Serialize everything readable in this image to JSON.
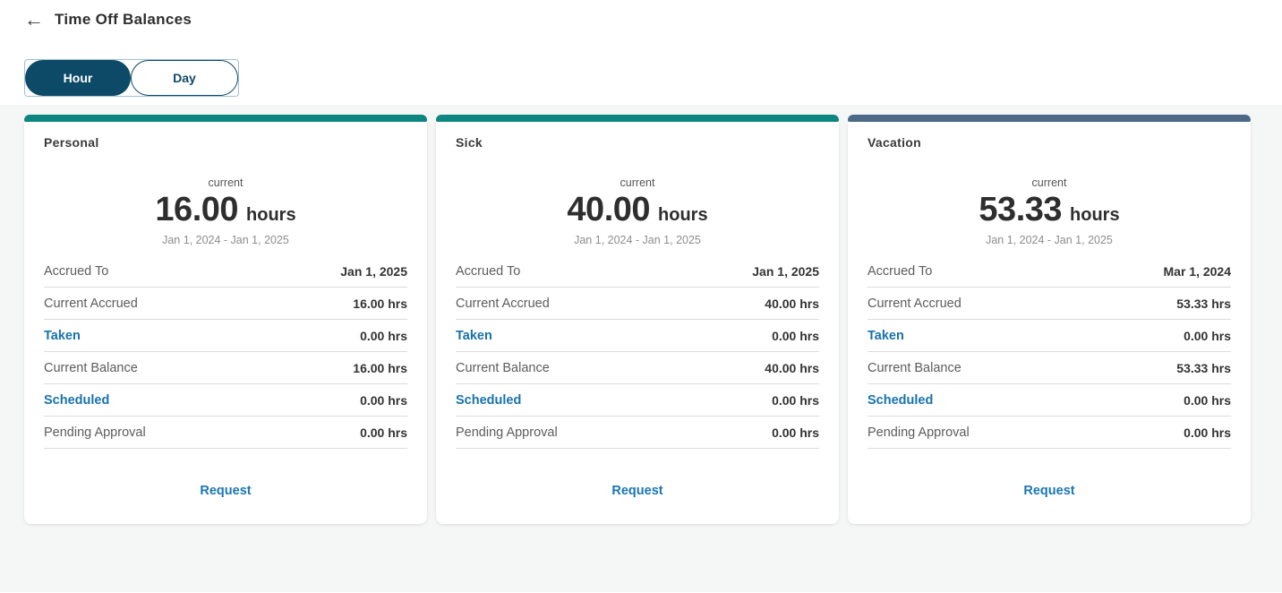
{
  "header": {
    "back_icon": "←",
    "title": "Time Off Balances"
  },
  "toggle": {
    "options": [
      {
        "label": "Hour",
        "selected": true
      },
      {
        "label": "Day",
        "selected": false
      }
    ]
  },
  "colors": {
    "teal_accent": "#0d8680",
    "slate_accent": "#4c6a87",
    "toggle_selected": "#0d4a67",
    "link_blue": "#1872ab",
    "content_background": "#f5f6f6"
  },
  "cards": [
    {
      "title": "Personal",
      "accent": "#0d8680",
      "current_label": "current",
      "amount": "16.00",
      "unit": "hours",
      "date_range": "Jan 1, 2024 - Jan 1, 2025",
      "rows": [
        {
          "label": "Accrued To",
          "value": "Jan 1, 2025",
          "link": false
        },
        {
          "label": "Current Accrued",
          "value": "16.00 hrs",
          "link": false
        },
        {
          "label": "Taken",
          "value": "0.00 hrs",
          "link": true
        },
        {
          "label": "Current Balance",
          "value": "16.00 hrs",
          "link": false
        },
        {
          "label": "Scheduled",
          "value": "0.00 hrs",
          "link": true
        },
        {
          "label": "Pending Approval",
          "value": "0.00 hrs",
          "link": false
        }
      ],
      "action": "Request"
    },
    {
      "title": "Sick",
      "accent": "#0d8680",
      "current_label": "current",
      "amount": "40.00",
      "unit": "hours",
      "date_range": "Jan 1, 2024 - Jan 1, 2025",
      "rows": [
        {
          "label": "Accrued To",
          "value": "Jan 1, 2025",
          "link": false
        },
        {
          "label": "Current Accrued",
          "value": "40.00 hrs",
          "link": false
        },
        {
          "label": "Taken",
          "value": "0.00 hrs",
          "link": true
        },
        {
          "label": "Current Balance",
          "value": "40.00 hrs",
          "link": false
        },
        {
          "label": "Scheduled",
          "value": "0.00 hrs",
          "link": true
        },
        {
          "label": "Pending Approval",
          "value": "0.00 hrs",
          "link": false
        }
      ],
      "action": "Request"
    },
    {
      "title": "Vacation",
      "accent": "#4c6a87",
      "current_label": "current",
      "amount": "53.33",
      "unit": "hours",
      "date_range": "Jan 1, 2024 - Jan 1, 2025",
      "rows": [
        {
          "label": "Accrued To",
          "value": "Mar 1, 2024",
          "link": false
        },
        {
          "label": "Current Accrued",
          "value": "53.33 hrs",
          "link": false
        },
        {
          "label": "Taken",
          "value": "0.00 hrs",
          "link": true
        },
        {
          "label": "Current Balance",
          "value": "53.33 hrs",
          "link": false
        },
        {
          "label": "Scheduled",
          "value": "0.00 hrs",
          "link": true
        },
        {
          "label": "Pending Approval",
          "value": "0.00 hrs",
          "link": false
        }
      ],
      "action": "Request"
    }
  ]
}
